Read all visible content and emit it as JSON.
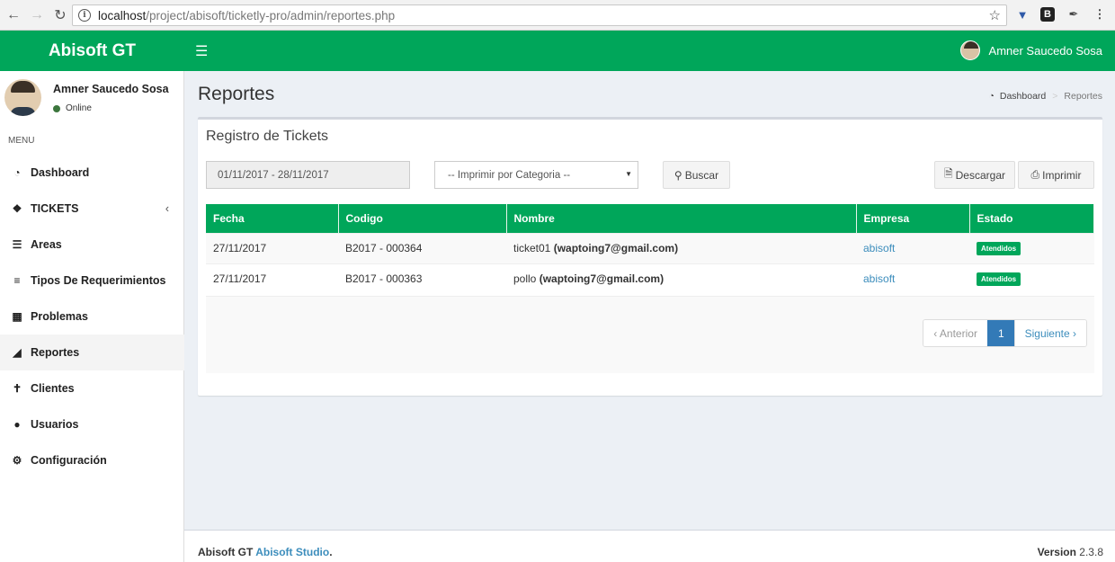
{
  "browser": {
    "url_host": "localhost",
    "url_path": "/project/abisoft/ticketly-pro/admin/reportes.php",
    "info_icon": "i",
    "extensions": [
      "download-icon",
      "b-icon",
      "eyedropper-icon",
      "menu-dots-icon"
    ],
    "ext_b": "B"
  },
  "header": {
    "logo": "Abisoft GT",
    "user_name": "Amner Saucedo Sosa",
    "accent_color": "#00a65a"
  },
  "sidebar": {
    "profile_name": "Amner Saucedo Sosa",
    "status": "Online",
    "menu_header": "MENU",
    "items": [
      {
        "label": "Dashboard",
        "icon": "dashboard-icon"
      },
      {
        "label": "TICKETS",
        "icon": "ticket-icon"
      },
      {
        "label": "Areas",
        "icon": "list-icon"
      },
      {
        "label": "Tipos De Requerimientos",
        "icon": "bars-icon"
      },
      {
        "label": "Problemas",
        "icon": "grid-icon"
      },
      {
        "label": "Reportes",
        "icon": "area-chart-icon"
      },
      {
        "label": "Clientes",
        "icon": "user-icon"
      },
      {
        "label": "Usuarios",
        "icon": "users-icon"
      },
      {
        "label": "Configuración",
        "icon": "gear-icon"
      }
    ]
  },
  "page": {
    "title": "Reportes",
    "breadcrumb_home": "Dashboard",
    "breadcrumb_current": "Reportes"
  },
  "report": {
    "box_title": "Registro de Tickets",
    "date_range": "01/11/2017 - 28/11/2017",
    "category_select": "-- Imprimir por Categoria --",
    "search_label": "Buscar",
    "download_label": "Descargar",
    "print_label": "Imprimir",
    "columns": [
      "Fecha",
      "Codigo",
      "Nombre",
      "Empresa",
      "Estado"
    ],
    "rows": [
      {
        "fecha": "27/11/2017",
        "codigo": "B2017 - 000364",
        "nombre": "ticket01",
        "email": "(waptoing7@gmail.com)",
        "empresa": "abisoft",
        "estado": "Atendidos"
      },
      {
        "fecha": "27/11/2017",
        "codigo": "B2017 - 000363",
        "nombre": "pollo",
        "email": "(waptoing7@gmail.com)",
        "empresa": "abisoft",
        "estado": "Atendidos"
      }
    ],
    "pagination": {
      "prev": "‹ Anterior",
      "current": "1",
      "next": "Siguiente ›"
    }
  },
  "footer": {
    "brand": "Abisoft GT",
    "studio": "Abisoft Studio",
    "period": ".",
    "version_label": "Version",
    "version": "2.3.8"
  }
}
